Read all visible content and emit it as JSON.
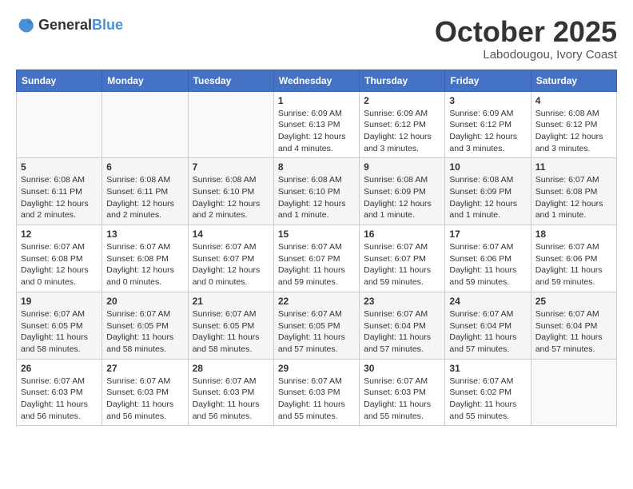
{
  "header": {
    "logo": {
      "general": "General",
      "blue": "Blue"
    },
    "title": "October 2025",
    "subtitle": "Labodougou, Ivory Coast"
  },
  "weekdays": [
    "Sunday",
    "Monday",
    "Tuesday",
    "Wednesday",
    "Thursday",
    "Friday",
    "Saturday"
  ],
  "weeks": [
    [
      {
        "day": "",
        "info": ""
      },
      {
        "day": "",
        "info": ""
      },
      {
        "day": "",
        "info": ""
      },
      {
        "day": "1",
        "info": "Sunrise: 6:09 AM\nSunset: 6:13 PM\nDaylight: 12 hours\nand 4 minutes."
      },
      {
        "day": "2",
        "info": "Sunrise: 6:09 AM\nSunset: 6:12 PM\nDaylight: 12 hours\nand 3 minutes."
      },
      {
        "day": "3",
        "info": "Sunrise: 6:09 AM\nSunset: 6:12 PM\nDaylight: 12 hours\nand 3 minutes."
      },
      {
        "day": "4",
        "info": "Sunrise: 6:08 AM\nSunset: 6:12 PM\nDaylight: 12 hours\nand 3 minutes."
      }
    ],
    [
      {
        "day": "5",
        "info": "Sunrise: 6:08 AM\nSunset: 6:11 PM\nDaylight: 12 hours\nand 2 minutes."
      },
      {
        "day": "6",
        "info": "Sunrise: 6:08 AM\nSunset: 6:11 PM\nDaylight: 12 hours\nand 2 minutes."
      },
      {
        "day": "7",
        "info": "Sunrise: 6:08 AM\nSunset: 6:10 PM\nDaylight: 12 hours\nand 2 minutes."
      },
      {
        "day": "8",
        "info": "Sunrise: 6:08 AM\nSunset: 6:10 PM\nDaylight: 12 hours\nand 1 minute."
      },
      {
        "day": "9",
        "info": "Sunrise: 6:08 AM\nSunset: 6:09 PM\nDaylight: 12 hours\nand 1 minute."
      },
      {
        "day": "10",
        "info": "Sunrise: 6:08 AM\nSunset: 6:09 PM\nDaylight: 12 hours\nand 1 minute."
      },
      {
        "day": "11",
        "info": "Sunrise: 6:07 AM\nSunset: 6:08 PM\nDaylight: 12 hours\nand 1 minute."
      }
    ],
    [
      {
        "day": "12",
        "info": "Sunrise: 6:07 AM\nSunset: 6:08 PM\nDaylight: 12 hours\nand 0 minutes."
      },
      {
        "day": "13",
        "info": "Sunrise: 6:07 AM\nSunset: 6:08 PM\nDaylight: 12 hours\nand 0 minutes."
      },
      {
        "day": "14",
        "info": "Sunrise: 6:07 AM\nSunset: 6:07 PM\nDaylight: 12 hours\nand 0 minutes."
      },
      {
        "day": "15",
        "info": "Sunrise: 6:07 AM\nSunset: 6:07 PM\nDaylight: 11 hours\nand 59 minutes."
      },
      {
        "day": "16",
        "info": "Sunrise: 6:07 AM\nSunset: 6:07 PM\nDaylight: 11 hours\nand 59 minutes."
      },
      {
        "day": "17",
        "info": "Sunrise: 6:07 AM\nSunset: 6:06 PM\nDaylight: 11 hours\nand 59 minutes."
      },
      {
        "day": "18",
        "info": "Sunrise: 6:07 AM\nSunset: 6:06 PM\nDaylight: 11 hours\nand 59 minutes."
      }
    ],
    [
      {
        "day": "19",
        "info": "Sunrise: 6:07 AM\nSunset: 6:05 PM\nDaylight: 11 hours\nand 58 minutes."
      },
      {
        "day": "20",
        "info": "Sunrise: 6:07 AM\nSunset: 6:05 PM\nDaylight: 11 hours\nand 58 minutes."
      },
      {
        "day": "21",
        "info": "Sunrise: 6:07 AM\nSunset: 6:05 PM\nDaylight: 11 hours\nand 58 minutes."
      },
      {
        "day": "22",
        "info": "Sunrise: 6:07 AM\nSunset: 6:05 PM\nDaylight: 11 hours\nand 57 minutes."
      },
      {
        "day": "23",
        "info": "Sunrise: 6:07 AM\nSunset: 6:04 PM\nDaylight: 11 hours\nand 57 minutes."
      },
      {
        "day": "24",
        "info": "Sunrise: 6:07 AM\nSunset: 6:04 PM\nDaylight: 11 hours\nand 57 minutes."
      },
      {
        "day": "25",
        "info": "Sunrise: 6:07 AM\nSunset: 6:04 PM\nDaylight: 11 hours\nand 57 minutes."
      }
    ],
    [
      {
        "day": "26",
        "info": "Sunrise: 6:07 AM\nSunset: 6:03 PM\nDaylight: 11 hours\nand 56 minutes."
      },
      {
        "day": "27",
        "info": "Sunrise: 6:07 AM\nSunset: 6:03 PM\nDaylight: 11 hours\nand 56 minutes."
      },
      {
        "day": "28",
        "info": "Sunrise: 6:07 AM\nSunset: 6:03 PM\nDaylight: 11 hours\nand 56 minutes."
      },
      {
        "day": "29",
        "info": "Sunrise: 6:07 AM\nSunset: 6:03 PM\nDaylight: 11 hours\nand 55 minutes."
      },
      {
        "day": "30",
        "info": "Sunrise: 6:07 AM\nSunset: 6:03 PM\nDaylight: 11 hours\nand 55 minutes."
      },
      {
        "day": "31",
        "info": "Sunrise: 6:07 AM\nSunset: 6:02 PM\nDaylight: 11 hours\nand 55 minutes."
      },
      {
        "day": "",
        "info": ""
      }
    ]
  ]
}
